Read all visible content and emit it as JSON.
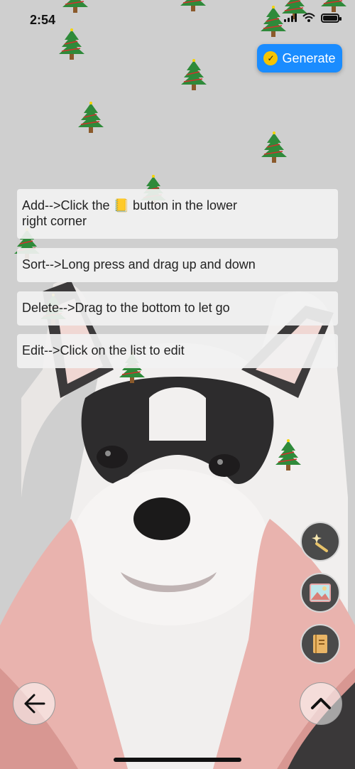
{
  "status_bar": {
    "time": "2:54"
  },
  "header": {
    "generate_label": "Generate"
  },
  "instructions": [
    {
      "line1": "Add-->Click the 📒 button in the lower",
      "line2": "right corner"
    },
    {
      "line1": "Sort-->Long press and drag up and down"
    },
    {
      "line1": "Delete-->Drag to the bottom to let go"
    },
    {
      "line1": "Edit-->Click on the list to edit"
    }
  ],
  "fab_icons": [
    "magic-wand-icon",
    "image-icon",
    "notebook-icon"
  ],
  "nav_icons": [
    "back-arrow-icon",
    "chevron-up-icon"
  ],
  "colors": {
    "accent": "#1a8cff",
    "tree": "#2f8a3a",
    "ornament": "#d2322d",
    "trunk": "#8b5a2b"
  }
}
